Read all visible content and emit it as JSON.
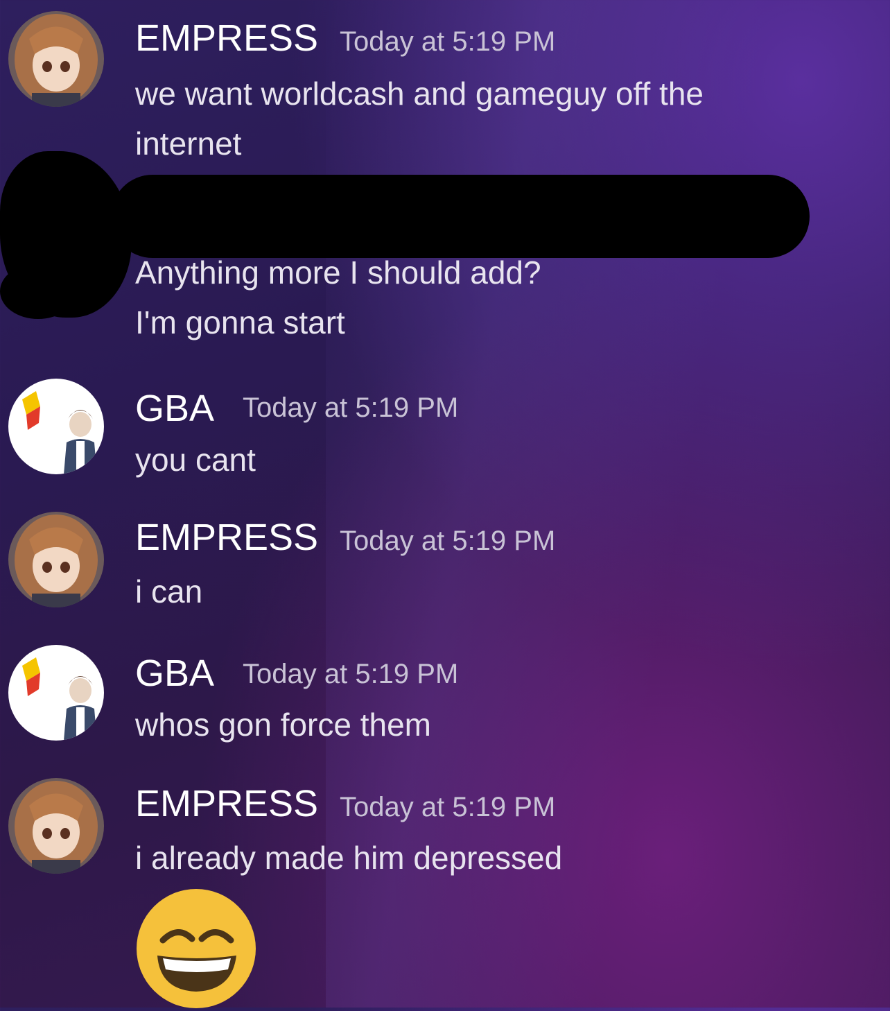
{
  "messages": [
    {
      "user": "EMPRESS",
      "time": "Today at 5:19 PM",
      "lines": [
        "we want worldcash and gameguy off the",
        "internet"
      ]
    },
    {
      "user": "",
      "time": "",
      "lines": [
        "Anything more I should add?",
        "I'm gonna start"
      ]
    },
    {
      "user": "GBA",
      "time": "Today at 5:19 PM",
      "lines": [
        "you cant"
      ]
    },
    {
      "user": "EMPRESS",
      "time": "Today at 5:19 PM",
      "lines": [
        "i can"
      ]
    },
    {
      "user": "GBA",
      "time": "Today at 5:19 PM",
      "lines": [
        "whos gon force them"
      ]
    },
    {
      "user": "EMPRESS",
      "time": "Today at 5:19 PM",
      "lines": [
        "i already made him depressed"
      ],
      "emoji": "grinning-squinting-face-emoji"
    }
  ],
  "colors": {
    "background": "#2a1a52",
    "username": "#ffffff",
    "timestamp": "#c9c3d6",
    "message": "#e8e4ef",
    "emoji_face": "#f5c13b",
    "redaction": "#000000"
  },
  "icons": {
    "empress_avatar": "anime-girl-avatar-icon",
    "gba_avatar": "boy-with-toy-avatar-icon"
  }
}
